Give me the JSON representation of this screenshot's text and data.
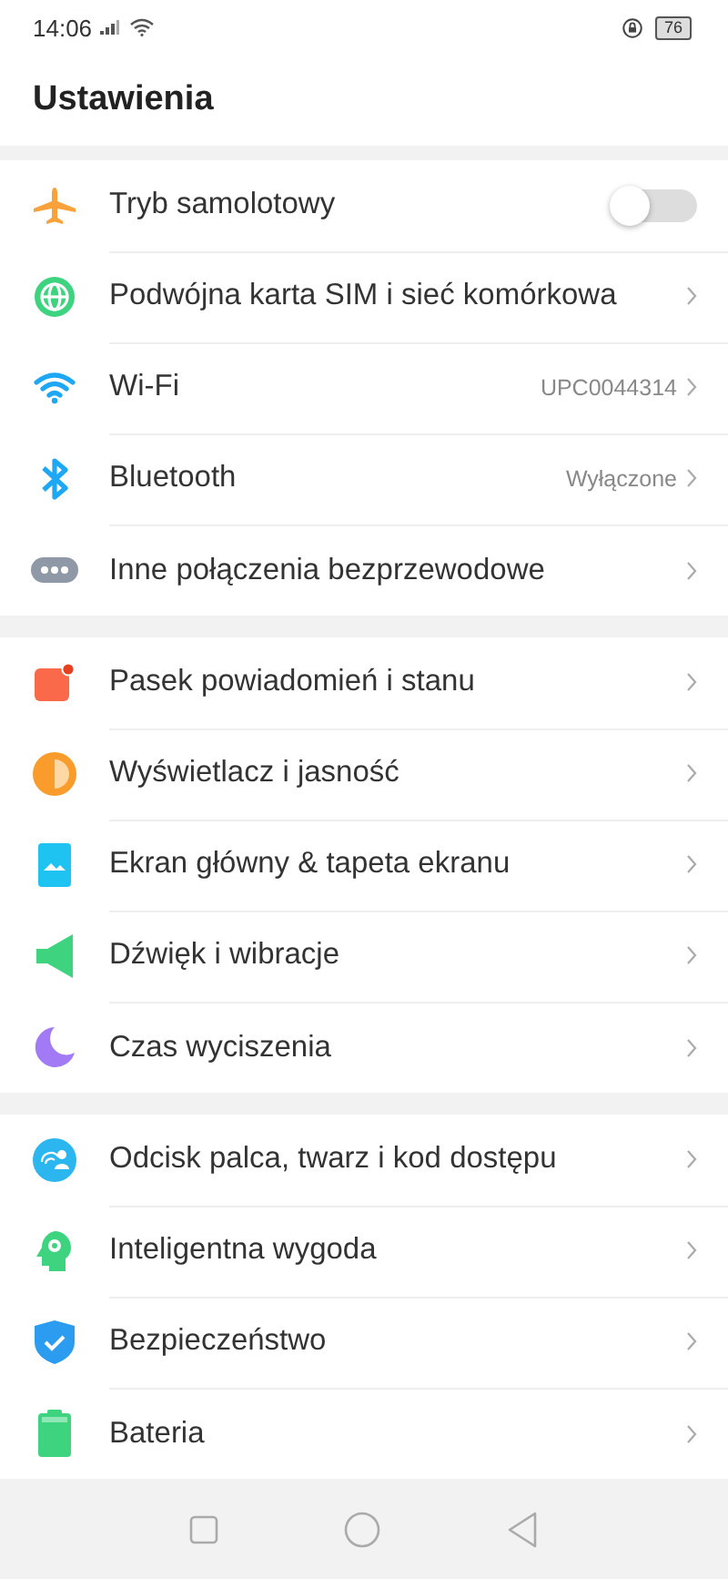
{
  "status_bar": {
    "time": "14:06",
    "battery": "76"
  },
  "title": "Ustawienia",
  "groups": [
    {
      "items": [
        {
          "label": "Tryb samolotowy",
          "kind": "toggle",
          "on": false
        },
        {
          "label": "Podwójna karta SIM i sieć komórkowa",
          "kind": "link"
        },
        {
          "label": "Wi-Fi",
          "kind": "link",
          "value": "UPC0044314"
        },
        {
          "label": "Bluetooth",
          "kind": "link",
          "value": "Wyłączone"
        },
        {
          "label": "Inne połączenia bezprzewodowe",
          "kind": "link"
        }
      ]
    },
    {
      "items": [
        {
          "label": "Pasek powiadomień i stanu",
          "kind": "link"
        },
        {
          "label": "Wyświetlacz i jasność",
          "kind": "link"
        },
        {
          "label": "Ekran główny & tapeta ekranu",
          "kind": "link"
        },
        {
          "label": "Dźwięk i wibracje",
          "kind": "link"
        },
        {
          "label": "Czas wyciszenia",
          "kind": "link"
        }
      ]
    },
    {
      "items": [
        {
          "label": "Odcisk palca, twarz i kod dostępu",
          "kind": "link"
        },
        {
          "label": "Inteligentna wygoda",
          "kind": "link"
        },
        {
          "label": "Bezpieczeństwo",
          "kind": "link"
        },
        {
          "label": "Bateria",
          "kind": "link"
        }
      ]
    }
  ]
}
